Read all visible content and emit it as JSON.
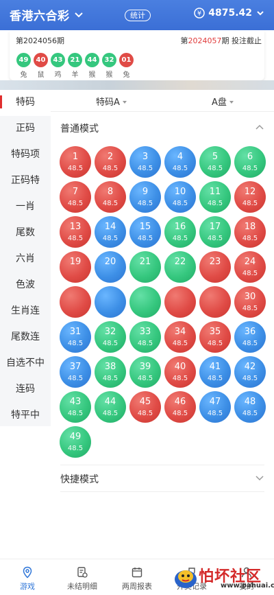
{
  "header": {
    "title": "香港六合彩",
    "stat_label": "统计",
    "balance": "4875.42",
    "bg_color": "#3b6fd6"
  },
  "draw": {
    "prev_period": "第2024056期",
    "next_prefix": "第",
    "next_number": "2024057",
    "next_suffix": "期 投注截止",
    "balls": [
      {
        "num": "49",
        "zodiac": "兔",
        "color": "green"
      },
      {
        "num": "40",
        "zodiac": "鼠",
        "color": "red"
      },
      {
        "num": "43",
        "zodiac": "鸡",
        "color": "green"
      },
      {
        "num": "21",
        "zodiac": "羊",
        "color": "green"
      },
      {
        "num": "44",
        "zodiac": "猴",
        "color": "green"
      },
      {
        "num": "32",
        "zodiac": "猴",
        "color": "green"
      },
      {
        "num": "01",
        "zodiac": "兔",
        "color": "red"
      }
    ]
  },
  "sidebar": {
    "items": [
      "特码",
      "正码",
      "特码项",
      "正码特",
      "一肖",
      "尾数",
      "六肖",
      "色波",
      "生肖连",
      "尾数连",
      "自选不中",
      "连码",
      "特平中"
    ],
    "active_index": 0
  },
  "subtabs": {
    "play": "特码A",
    "plate": "A盘"
  },
  "sections": {
    "normal": "普通模式",
    "quick": "快捷模式"
  },
  "balls": [
    {
      "n": "1",
      "odds": "48.5",
      "c": "red"
    },
    {
      "n": "2",
      "odds": "48.5",
      "c": "red"
    },
    {
      "n": "3",
      "odds": "48.5",
      "c": "blue"
    },
    {
      "n": "4",
      "odds": "48.5",
      "c": "blue"
    },
    {
      "n": "5",
      "odds": "48.5",
      "c": "green"
    },
    {
      "n": "6",
      "odds": "48.5",
      "c": "green"
    },
    {
      "n": "7",
      "odds": "48.5",
      "c": "red"
    },
    {
      "n": "8",
      "odds": "48.5",
      "c": "red"
    },
    {
      "n": "9",
      "odds": "48.5",
      "c": "blue"
    },
    {
      "n": "10",
      "odds": "48.5",
      "c": "blue"
    },
    {
      "n": "11",
      "odds": "48.5",
      "c": "green"
    },
    {
      "n": "12",
      "odds": "48.5",
      "c": "red"
    },
    {
      "n": "13",
      "odds": "48.5",
      "c": "red"
    },
    {
      "n": "14",
      "odds": "48.5",
      "c": "blue"
    },
    {
      "n": "15",
      "odds": "48.5",
      "c": "blue"
    },
    {
      "n": "16",
      "odds": "48.5",
      "c": "green"
    },
    {
      "n": "17",
      "odds": "48.5",
      "c": "green"
    },
    {
      "n": "18",
      "odds": "48.5",
      "c": "red"
    },
    {
      "n": "19",
      "odds": "",
      "c": "red"
    },
    {
      "n": "20",
      "odds": "",
      "c": "blue"
    },
    {
      "n": "21",
      "odds": "",
      "c": "green"
    },
    {
      "n": "22",
      "odds": "",
      "c": "green"
    },
    {
      "n": "23",
      "odds": "",
      "c": "red"
    },
    {
      "n": "24",
      "odds": "48.5",
      "c": "red"
    },
    {
      "n": "",
      "odds": "",
      "c": "red"
    },
    {
      "n": "",
      "odds": "",
      "c": "blue"
    },
    {
      "n": "",
      "odds": "",
      "c": "green"
    },
    {
      "n": "",
      "odds": "",
      "c": "red"
    },
    {
      "n": "",
      "odds": "",
      "c": "red"
    },
    {
      "n": "30",
      "odds": "48.5",
      "c": "red"
    },
    {
      "n": "31",
      "odds": "48.5",
      "c": "blue"
    },
    {
      "n": "32",
      "odds": "48.5",
      "c": "green"
    },
    {
      "n": "33",
      "odds": "48.5",
      "c": "green"
    },
    {
      "n": "34",
      "odds": "48.5",
      "c": "red"
    },
    {
      "n": "35",
      "odds": "48.5",
      "c": "red"
    },
    {
      "n": "36",
      "odds": "48.5",
      "c": "blue"
    },
    {
      "n": "37",
      "odds": "48.5",
      "c": "blue"
    },
    {
      "n": "38",
      "odds": "48.5",
      "c": "green"
    },
    {
      "n": "39",
      "odds": "48.5",
      "c": "green"
    },
    {
      "n": "40",
      "odds": "48.5",
      "c": "red"
    },
    {
      "n": "41",
      "odds": "48.5",
      "c": "blue"
    },
    {
      "n": "42",
      "odds": "48.5",
      "c": "blue"
    },
    {
      "n": "43",
      "odds": "48.5",
      "c": "green"
    },
    {
      "n": "44",
      "odds": "48.5",
      "c": "green"
    },
    {
      "n": "45",
      "odds": "48.5",
      "c": "red"
    },
    {
      "n": "46",
      "odds": "48.5",
      "c": "red"
    },
    {
      "n": "47",
      "odds": "48.5",
      "c": "blue"
    },
    {
      "n": "48",
      "odds": "48.5",
      "c": "blue"
    },
    {
      "n": "49",
      "odds": "48.5",
      "c": "green"
    }
  ],
  "bottom_nav": [
    {
      "label": "游戏",
      "icon": "location-pin-icon",
      "active": true
    },
    {
      "label": "未结明细",
      "icon": "document-clock-icon",
      "active": false
    },
    {
      "label": "两周报表",
      "icon": "calendar-icon",
      "active": false
    },
    {
      "label": "开奖记录",
      "icon": "trophy-icon",
      "active": false
    },
    {
      "label": "我的",
      "icon": "user-icon",
      "active": false
    }
  ],
  "watermark": {
    "text": "怕坏社区",
    "url": "www.pahuai.com"
  }
}
